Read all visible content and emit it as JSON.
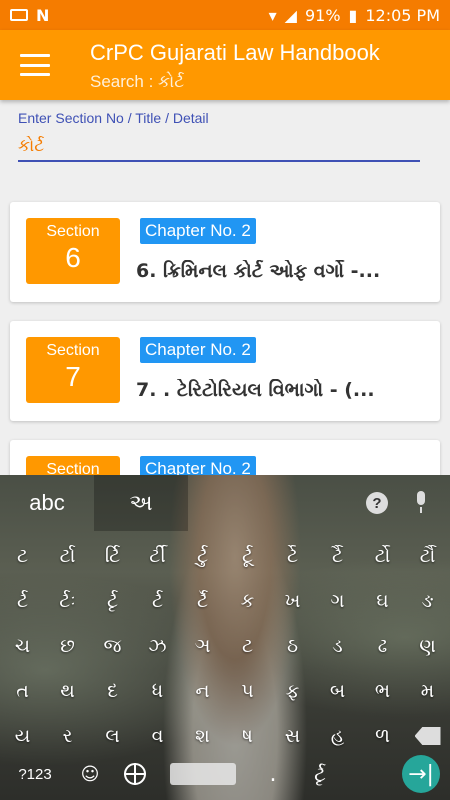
{
  "status_bar": {
    "battery": "91%",
    "time": "12:05 PM"
  },
  "app_bar": {
    "title": "CrPC Gujarati Law Handbook",
    "subtitle": "Search : કોર્ટ"
  },
  "search": {
    "label": "Enter Section No / Title / Detail",
    "value": "કોર્ટ"
  },
  "results": [
    {
      "section_label": "Section",
      "section_no": "6",
      "chapter": "Chapter No. 2",
      "title": "6. ક્રિમિનલ કોર્ટ ઓફ વર્ગો -..."
    },
    {
      "section_label": "Section",
      "section_no": "7",
      "chapter": "Chapter No. 2",
      "title": "7. . ટેરિટોરિયલ વિભાગો -  (..."
    },
    {
      "section_label": "Section",
      "section_no": "",
      "chapter": "Chapter No. 2",
      "title": ""
    }
  ],
  "keyboard": {
    "tab_latin": "abc",
    "tab_native": "અ",
    "rows": [
      [
        "ટ",
        "ર્ટા",
        "ર્ટિ",
        "ર્ટી",
        "ર્ટુ",
        "ર્ટૂ",
        "ર્ટે",
        "ર્ટૈ",
        "ર્ટો",
        "ર્ટૌ"
      ],
      [
        "ર્ટ",
        "ર્ટઃ",
        "ર્ટૃ",
        "ર્ટ",
        "ર્ટૅ",
        "ક",
        "ખ",
        "ગ",
        "ઘ",
        "ઙ"
      ],
      [
        "ચ",
        "છ",
        "જ",
        "ઝ",
        "ઞ",
        "ટ",
        "ઠ",
        "ડ",
        "ઢ",
        "ણ"
      ],
      [
        "ત",
        "થ",
        "દ",
        "ધ",
        "ન",
        "પ",
        "ફ",
        "બ",
        "ભ",
        "મ"
      ],
      [
        "ય",
        "ર",
        "લ",
        "વ",
        "શ",
        "ષ",
        "સ",
        "હ",
        "ળ",
        ""
      ]
    ],
    "symbols_label": "?123",
    "emoji_label": "☺",
    "bottom_dot": ".",
    "bottom_char": "ર્ટૃ",
    "enter_icon": "→|"
  }
}
